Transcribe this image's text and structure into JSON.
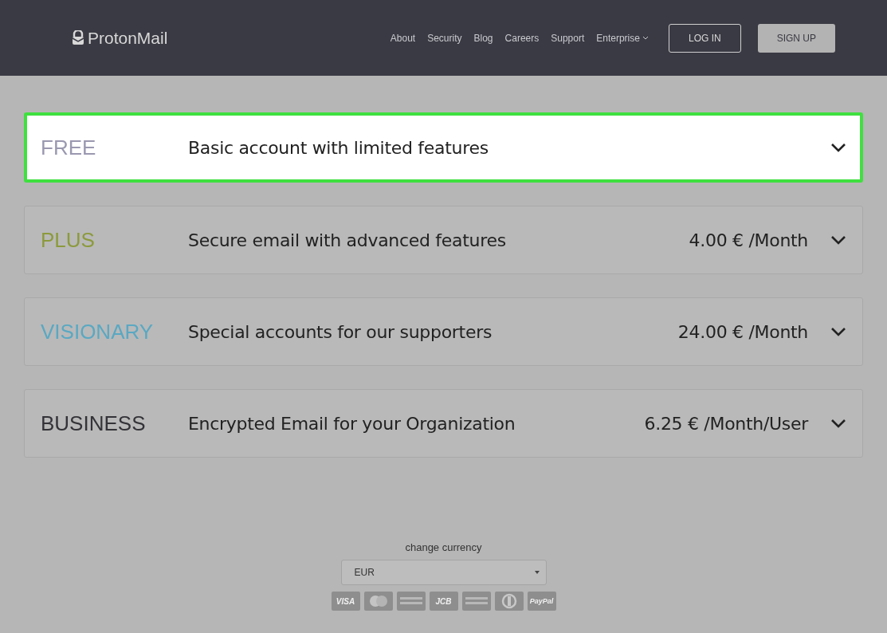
{
  "header": {
    "logo": "ProtonMail",
    "nav": [
      {
        "label": "About",
        "dropdown": false
      },
      {
        "label": "Security",
        "dropdown": false
      },
      {
        "label": "Blog",
        "dropdown": false
      },
      {
        "label": "Careers",
        "dropdown": false
      },
      {
        "label": "Support",
        "dropdown": false
      },
      {
        "label": "Enterprise",
        "dropdown": true
      }
    ],
    "login": "LOG IN",
    "signup": "SIGN UP"
  },
  "plans": [
    {
      "name": "FREE",
      "description": "Basic account with limited features",
      "color": "#9a98b0",
      "selected": true
    },
    {
      "name": "PLUS",
      "description": "Secure email with advanced features",
      "price": "4.00 € /Month",
      "color": "#8c9a3c",
      "selected": false
    },
    {
      "name": "VISIONARY",
      "description": "Special accounts for our supporters",
      "price": "24.00 € /Month",
      "color": "#5aa8c2",
      "selected": false
    },
    {
      "name": "BUSINESS",
      "description": "Encrypted Email for your Organization",
      "price": "6.25 € /Month/User",
      "color": "#333338",
      "selected": false
    }
  ],
  "currency": {
    "label": "change currency",
    "value": "EUR"
  },
  "payment_methods": [
    {
      "kind": "text",
      "label": "VISA"
    },
    {
      "kind": "circles"
    },
    {
      "kind": "lines"
    },
    {
      "kind": "text",
      "label": "JCB"
    },
    {
      "kind": "lines"
    },
    {
      "kind": "ring"
    },
    {
      "kind": "text",
      "label": "PayPal"
    }
  ]
}
